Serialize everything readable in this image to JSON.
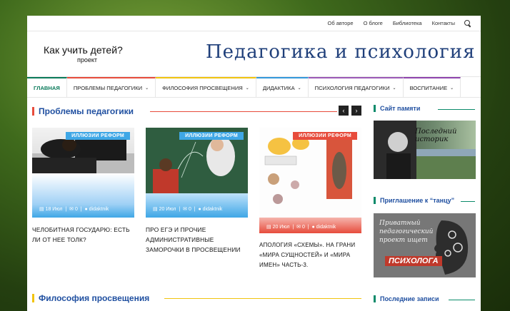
{
  "topbar": {
    "links": [
      "Об авторе",
      "О блоге",
      "Библиотека",
      "Контакты"
    ]
  },
  "header": {
    "brand_title": "Как учить детей?",
    "brand_sub": "проект",
    "site_title": "Педагогика и психология"
  },
  "nav": {
    "items": [
      {
        "label": "ГЛАВНАЯ",
        "color": "#0a7a5a"
      },
      {
        "label": "ПРОБЛЕМЫ ПЕДАГОГИКИ",
        "color": "#e74c3c"
      },
      {
        "label": "ФИЛОСОФИЯ ПРОСВЕЩЕНИЯ",
        "color": "#f1c40f"
      },
      {
        "label": "ДИДАКТИКА",
        "color": "#3498db"
      },
      {
        "label": "ПСИХОЛОГИЯ ПЕДАГОГИКИ",
        "color": "#9b59b6"
      },
      {
        "label": "ВОСПИТАНИЕ",
        "color": "#8e44ad"
      }
    ]
  },
  "sections": {
    "problems": {
      "title": "Проблемы педагогики",
      "color": "#e74c3c"
    },
    "philosophy": {
      "title": "Философия просвещения",
      "color": "#f1c40f"
    }
  },
  "cards": [
    {
      "badge": "ИЛЛЮЗИИ РЕФОРМ",
      "date": "18 Июл",
      "comments": "0",
      "author": "didaktnik",
      "headline": "ЧЕЛОБИТНАЯ ГОСУДАРЮ: ЕСТЬ ЛИ ОТ НЕЕ ТОЛК?"
    },
    {
      "badge": "ИЛЛЮЗИИ РЕФОРМ",
      "date": "20 Июл",
      "comments": "0",
      "author": "didaktnik",
      "headline": "ПРО ЕГЭ И ПРОЧИЕ АДМИНИСТРАТИВНЫЕ ЗАМОРОЧКИ В ПРОСВЕЩЕНИИ"
    },
    {
      "badge": "ИЛЛЮЗИИ РЕФОРМ",
      "date": "20 Июл",
      "comments": "0",
      "author": "didaktnik",
      "headline": "АПОЛОГИЯ «СХЕМЫ». НА ГРАНИ «МИРА СУЩНОСТЕЙ» И «МИРА ИМЕН» Часть-3."
    }
  ],
  "sidebar": {
    "memory": {
      "title": "Сайт памяти",
      "banner_text": "Последний историк"
    },
    "invite": {
      "title": "Приглашение к “танцу”",
      "banner_text": "Приватный педагогический проект ищет",
      "banner_accent": "ПСИХОЛОГА"
    },
    "recent": {
      "title": "Последние записи"
    }
  }
}
